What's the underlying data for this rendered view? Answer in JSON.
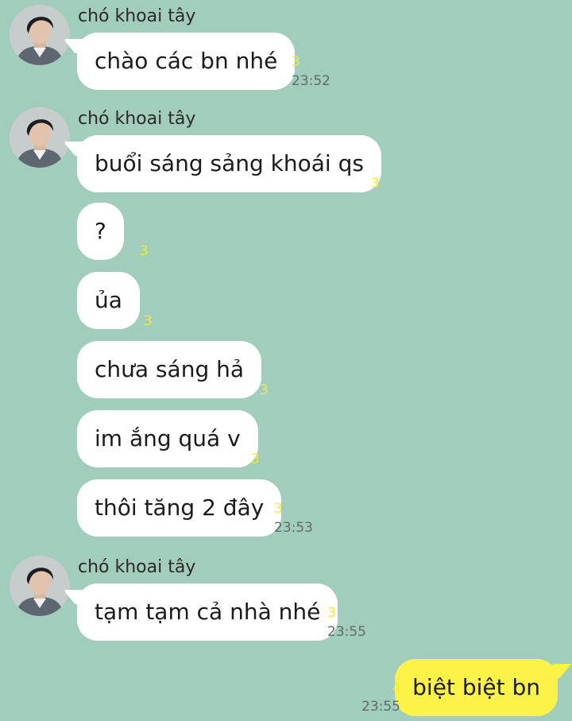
{
  "chat": {
    "background": "#a2cdbd",
    "bubble_color_incoming": "#ffffff",
    "bubble_color_outgoing": "#fdf247",
    "unread_color": "#f2ea3a",
    "sender_name": "chó khoai tây",
    "groups": [
      {
        "sender": "chó khoai tây",
        "messages": [
          {
            "text": "chào các bn nhé",
            "unread": "3",
            "time": "23:52"
          }
        ]
      },
      {
        "sender": "chó khoai tây",
        "messages": [
          {
            "text": "buổi sáng sảng khoái qs",
            "unread": "3"
          },
          {
            "text": "?",
            "unread": "3"
          },
          {
            "text": "ủa",
            "unread": "3"
          },
          {
            "text": "chưa sáng hả",
            "unread": "3"
          },
          {
            "text": "im ắng quá v",
            "unread": "3"
          },
          {
            "text": "thôi tăng 2 đây",
            "unread": "3",
            "time": "23:53"
          }
        ]
      },
      {
        "sender": "chó khoai tây",
        "messages": [
          {
            "text": "tạm tạm cả nhà nhé",
            "unread": "3",
            "time": "23:55"
          }
        ]
      }
    ],
    "outgoing": [
      {
        "text": "biệt biệt bn",
        "unread": "4",
        "time": "23:55"
      }
    ]
  }
}
